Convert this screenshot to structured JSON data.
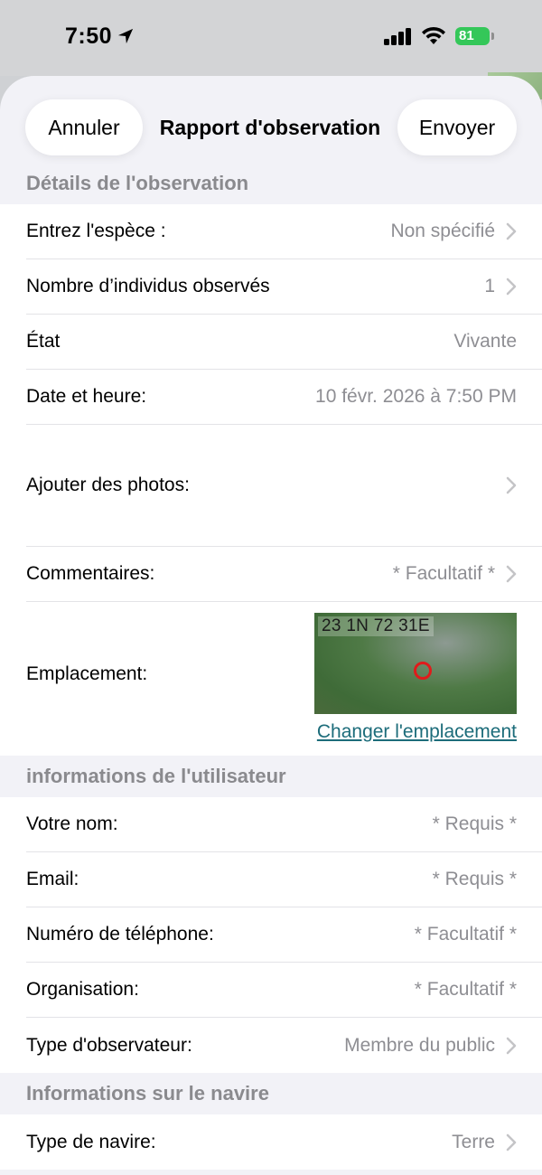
{
  "status": {
    "time": "7:50",
    "battery": "81"
  },
  "nav": {
    "cancel_label": "Annuler",
    "title": "Rapport d'observation",
    "send_label": "Envoyer"
  },
  "sections": {
    "observation": {
      "header": "Détails de l'observation",
      "rows": [
        {
          "label": "Entrez l'espèce :",
          "value": "Non spécifié"
        },
        {
          "label": "Nombre d’individus observés",
          "value": "1"
        },
        {
          "label": "État",
          "value": "Vivante"
        },
        {
          "label": "Date et heure:",
          "value": "10 févr. 2026 à 7:50 PM"
        },
        {
          "label": "Ajouter des photos:",
          "value": ""
        },
        {
          "label": "Commentaires:",
          "value": "* Facultatif *"
        }
      ],
      "location": {
        "label": "Emplacement:",
        "coords": "23 1N   72 31E",
        "change_link": "Changer l'emplacement"
      }
    },
    "user": {
      "header": "informations de l'utilisateur",
      "rows": [
        {
          "label": "Votre nom:",
          "value": "* Requis *"
        },
        {
          "label": "Email:",
          "value": "* Requis *"
        },
        {
          "label": "Numéro de téléphone:",
          "value": "* Facultatif *"
        },
        {
          "label": "Organisation:",
          "value": "* Facultatif *"
        },
        {
          "label": "Type d'observateur:",
          "value": "Membre du public"
        }
      ]
    },
    "vessel": {
      "header": "Informations sur le navire",
      "rows": [
        {
          "label": "Type de navire:",
          "value": "Terre"
        }
      ]
    }
  },
  "colors": {
    "accent_link": "#1c6c7a",
    "battery": "#34c759",
    "pin": "#e01b1b"
  }
}
